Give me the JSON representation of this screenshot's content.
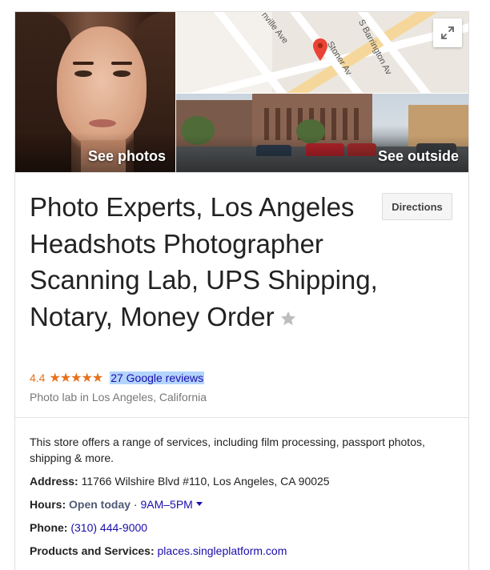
{
  "photos": {
    "see_photos_label": "See photos",
    "see_outside_label": "See outside"
  },
  "map": {
    "street_labels": [
      "nville Ave",
      "S Barrington Av",
      "Stoner Av"
    ]
  },
  "business": {
    "name": "Photo Experts, Los Angeles Headshots Photographer Scanning Lab, UPS Shipping, Notary, Money Order",
    "directions_label": "Directions",
    "rating": "4.4",
    "stars": "★★★★★",
    "rating_value": 4.4,
    "reviews_label": "27 Google reviews",
    "category": "Photo lab in Los Angeles, California"
  },
  "details": {
    "description": "This store offers a range of services, including film processing, passport photos, shipping & more.",
    "address_label": "Address:",
    "address_value": "11766 Wilshire Blvd #110, Los Angeles, CA 90025",
    "hours_label": "Hours:",
    "hours_status": "Open today",
    "hours_sep": "·",
    "hours_value": "9AM–5PM",
    "phone_label": "Phone:",
    "phone_value": "(310) 444-9000",
    "products_label": "Products and Services:",
    "products_value": "places.singleplatform.com"
  },
  "colors": {
    "rating": "#e7711b",
    "link": "#1a0dab",
    "highlight": "#b3d4fc",
    "map_pin": "#ea4335"
  }
}
